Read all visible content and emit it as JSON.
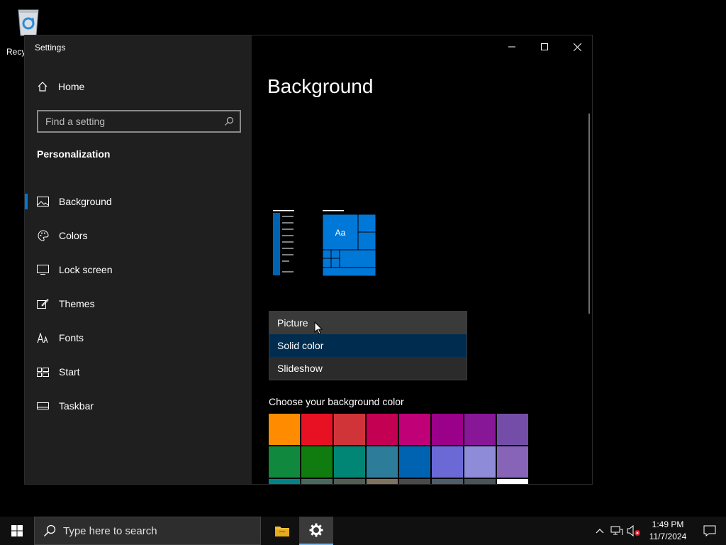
{
  "desktop": {
    "recycle_label": "Recy"
  },
  "window": {
    "title": "Settings",
    "controls": {
      "minimize": "─",
      "maximize": "☐",
      "close": "✕"
    }
  },
  "sidebar": {
    "home_label": "Home",
    "search_placeholder": "Find a setting",
    "section_title": "Personalization",
    "items": [
      {
        "label": "Background",
        "icon": "picture-icon",
        "active": true
      },
      {
        "label": "Colors",
        "icon": "palette-icon"
      },
      {
        "label": "Lock screen",
        "icon": "lock-screen-icon"
      },
      {
        "label": "Themes",
        "icon": "themes-icon"
      },
      {
        "label": "Fonts",
        "icon": "fonts-icon"
      },
      {
        "label": "Start",
        "icon": "start-icon"
      },
      {
        "label": "Taskbar",
        "icon": "taskbar-icon"
      }
    ]
  },
  "main": {
    "title": "Background",
    "preview_text": "Aa",
    "dropdown": {
      "options": [
        "Picture",
        "Solid color",
        "Slideshow"
      ],
      "hovered": "Picture",
      "selected": "Solid color"
    },
    "color_label": "Choose your background color",
    "swatches": [
      "#ff8c00",
      "#e81123",
      "#d13438",
      "#c30052",
      "#bf0077",
      "#9a0089",
      "#881798",
      "#744da9",
      "#10893e",
      "#107c10",
      "#018574",
      "#2d7d9a",
      "#0063b1",
      "#6b69d6",
      "#8e8cd8",
      "#8764b8",
      "#038387",
      "#486860",
      "#525e54",
      "#7e735f",
      "#4c4a48",
      "#515c6b",
      "#4a5459",
      "#ffffff"
    ],
    "accent_color": "#0078d7"
  },
  "taskbar": {
    "search_placeholder": "Type here to search",
    "time": "1:49 PM",
    "date": "11/7/2024"
  }
}
